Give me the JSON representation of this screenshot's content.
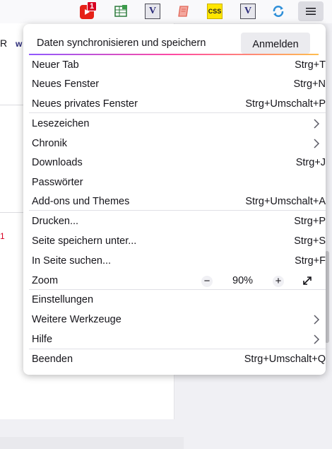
{
  "toolbar": {
    "youtube_badge": "1",
    "css_label": "CSS",
    "v_label": "V"
  },
  "page": {
    "fragment_r": "R",
    "fragment_w": "w",
    "fragment_red": "1"
  },
  "panel": {
    "sync_label": "Daten synchronisieren und speichern",
    "signin_label": "Anmelden",
    "items": {
      "new_tab": {
        "label": "Neuer Tab",
        "shortcut": "Strg+T"
      },
      "new_window": {
        "label": "Neues Fenster",
        "shortcut": "Strg+N"
      },
      "private_window": {
        "label": "Neues privates Fenster",
        "shortcut": "Strg+Umschalt+P"
      },
      "bookmarks": {
        "label": "Lesezeichen"
      },
      "history": {
        "label": "Chronik"
      },
      "downloads": {
        "label": "Downloads",
        "shortcut": "Strg+J"
      },
      "passwords": {
        "label": "Passwörter"
      },
      "addons": {
        "label": "Add-ons und Themes",
        "shortcut": "Strg+Umschalt+A"
      },
      "print": {
        "label": "Drucken...",
        "shortcut": "Strg+P"
      },
      "save_page": {
        "label": "Seite speichern unter...",
        "shortcut": "Strg+S"
      },
      "find": {
        "label": "In Seite suchen...",
        "shortcut": "Strg+F"
      },
      "zoom": {
        "label": "Zoom",
        "value": "90%",
        "minus": "−",
        "plus": "+"
      },
      "settings": {
        "label": "Einstellungen"
      },
      "more_tools": {
        "label": "Weitere Werkzeuge"
      },
      "help": {
        "label": "Hilfe"
      },
      "quit": {
        "label": "Beenden",
        "shortcut": "Strg+Umschalt+Q"
      }
    }
  },
  "colors": {
    "accent_gradient": [
      "#9059ff",
      "#ff4aa2",
      "#ffbd4f"
    ],
    "youtube": "#e62117",
    "badge": "#d70022"
  }
}
